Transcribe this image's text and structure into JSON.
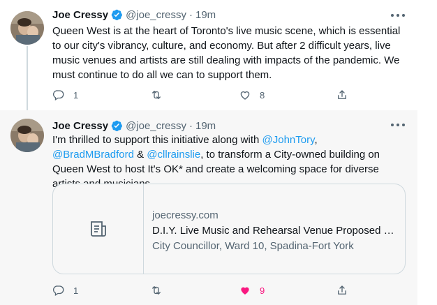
{
  "colors": {
    "accent": "#1d9bf0",
    "like_active": "#f91880",
    "muted_text": "#536471"
  },
  "tweets": [
    {
      "author_name": "Joe Cressy",
      "handle": "@joe_cressy",
      "separator": "·",
      "time": "19m",
      "verified_icon": "verified-badge-icon",
      "text": "Queen West is at the heart of Toronto's live music scene, which is essential to our city's vibrancy, culture, and economy. But after 2 difficult years, live music venues and artists are still dealing with impacts of the pandemic. We must continue to do all we can to support them.",
      "replies": "1",
      "retweets": "",
      "likes": "8",
      "liked": false
    },
    {
      "author_name": "Joe Cressy",
      "handle": "@joe_cressy",
      "separator": "·",
      "time": "19m",
      "verified_icon": "verified-badge-icon",
      "text_parts": {
        "t1": "I'm thrilled to support this initiative along with ",
        "m1": "@JohnTory",
        "t2": ", ",
        "m2": "@BradMBradford",
        "t3": " & ",
        "m3": "@cllrainslie",
        "t4": ", to transform a City-owned building on Queen West to host It's OK* and create a welcoming space for diverse artists and musicians."
      },
      "card": {
        "icon": "article-icon",
        "domain": "joecressy.com",
        "title": "D.I.Y. Live Music and Rehearsal Venue Proposed fo...",
        "description": "City Councillor, Ward 10, Spadina-Fort York"
      },
      "replies": "1",
      "retweets": "",
      "likes": "9",
      "liked": true
    }
  ]
}
